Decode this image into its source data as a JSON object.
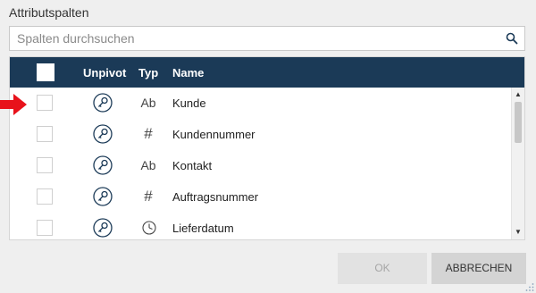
{
  "dialog": {
    "title": "Attributspalten",
    "search": {
      "placeholder": "Spalten durchsuchen",
      "value": ""
    },
    "table": {
      "columns": [
        "Unpivot",
        "Typ",
        "Name"
      ],
      "rows": [
        {
          "type": "Ab",
          "type_icon": "text-type-icon",
          "name": "Kunde",
          "checked": false
        },
        {
          "type": "#",
          "type_icon": "number-type-icon",
          "name": "Kundennummer",
          "checked": false
        },
        {
          "type": "Ab",
          "type_icon": "text-type-icon",
          "name": "Kontakt",
          "checked": false
        },
        {
          "type": "#",
          "type_icon": "number-type-icon",
          "name": "Auftragsnummer",
          "checked": false
        },
        {
          "type": "",
          "type_icon": "clock-type-icon",
          "name": "Lieferdatum",
          "checked": false
        }
      ]
    },
    "buttons": {
      "ok": "OK",
      "cancel": "ABBRECHEN"
    },
    "colors": {
      "header_bg": "#1b3a57",
      "accent": "#1b3a57",
      "arrow": "#e8121b"
    }
  }
}
